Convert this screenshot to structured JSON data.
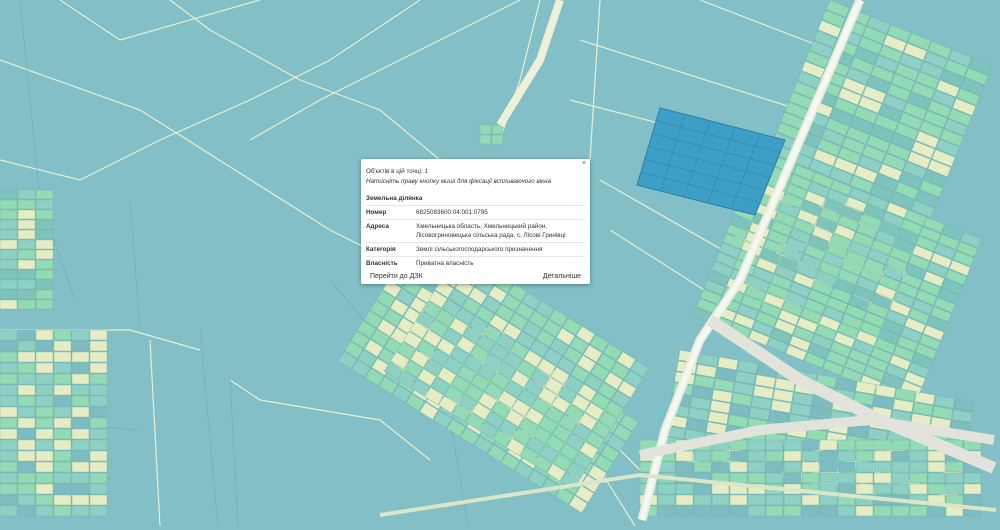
{
  "colors": {
    "base": "#82bfc6",
    "parcel": "#8ed0c3",
    "green": "#93dbb4",
    "yellow": "#e6ecc4",
    "road": "#eef0e6",
    "selected": "#3d9fc6"
  },
  "popup": {
    "close": "×",
    "objects_count": "Об'єктів в цій точці: 1",
    "hint": "Натисніть праву кнопку миші для фіксації вспливаючого вікна",
    "section_title": "Земельна ділянка",
    "rows": [
      {
        "key": "Номер",
        "value": "6825083600:04:001:0795"
      },
      {
        "key": "Адреса",
        "value": "Хмельницька область, Хмельницький район, Лісовогриновецька сільська рада, с. Лісові Гринівці"
      },
      {
        "key": "Категорія",
        "value": "Землі сільськогосподарського призначення"
      },
      {
        "key": "Власність",
        "value": "Приватна власність"
      }
    ],
    "goto_label": "Перейти до ДЗК",
    "details_label": "Детальніше"
  }
}
